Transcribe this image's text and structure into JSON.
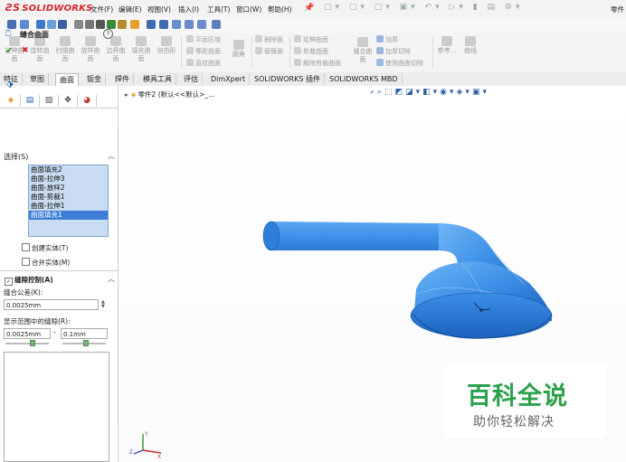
{
  "app": {
    "logo_text": "SOLIDWORKS",
    "doc_title": "零件",
    "menu": [
      "文件(F)",
      "编辑(E)",
      "视图(V)",
      "插入(I)",
      "工具(T)",
      "窗口(W)",
      "帮助(H)"
    ]
  },
  "ribbon": {
    "big_buttons": [
      "拉伸曲面",
      "旋转曲面",
      "扫描曲面",
      "放样曲面",
      "边界曲面",
      "填充曲面",
      "自由形"
    ],
    "group1": [
      "平面区域",
      "等距曲面",
      "直纹曲面"
    ],
    "fillet_label": "圆角",
    "group2": [
      "删除面",
      "替换面"
    ],
    "group3": [
      "延伸曲面",
      "剪裁曲面",
      "解除剪裁曲面"
    ],
    "knit_label": "缝合曲面",
    "group4": [
      "加厚",
      "加厚切除",
      "使用曲面切除"
    ],
    "ref_label": "参考...",
    "curve_label": "曲线"
  },
  "tabs": [
    "特征",
    "草图",
    "曲面",
    "钣金",
    "焊件",
    "模具工具",
    "评估",
    "DimXpert",
    "SOLIDWORKS 插件",
    "SOLIDWORKS MBD"
  ],
  "active_tab": "曲面",
  "property_manager": {
    "title": "缝合曲面",
    "selection_header": "选择(S)",
    "selections": [
      "曲面填充2",
      "曲面-拉伸3",
      "曲面-放样2",
      "曲面-剪裁1",
      "曲面-拉伸1",
      "曲面填充1"
    ],
    "highlighted_index": 5,
    "create_solid": "创建实体(T)",
    "merge_entities": "合并实体(M)",
    "gap_control": "缝隙控制(A)",
    "knit_tolerance_label": "缝合公差(K):",
    "knit_tolerance_value": "0.0025mm",
    "gap_range_label": "显示范围中的缝隙(R):",
    "gap_min": "0.0025mm",
    "gap_max": "0.1mm",
    "range_dash": "-"
  },
  "viewport": {
    "feature_tree_label": "零件2 (默认<<默认>_...",
    "model_color": "#3c8fe6"
  },
  "watermark": {
    "big": "百科全说",
    "small": "助你轻松解决"
  },
  "triad_labels": {
    "x": "X",
    "y": "Y",
    "z": "Z"
  }
}
